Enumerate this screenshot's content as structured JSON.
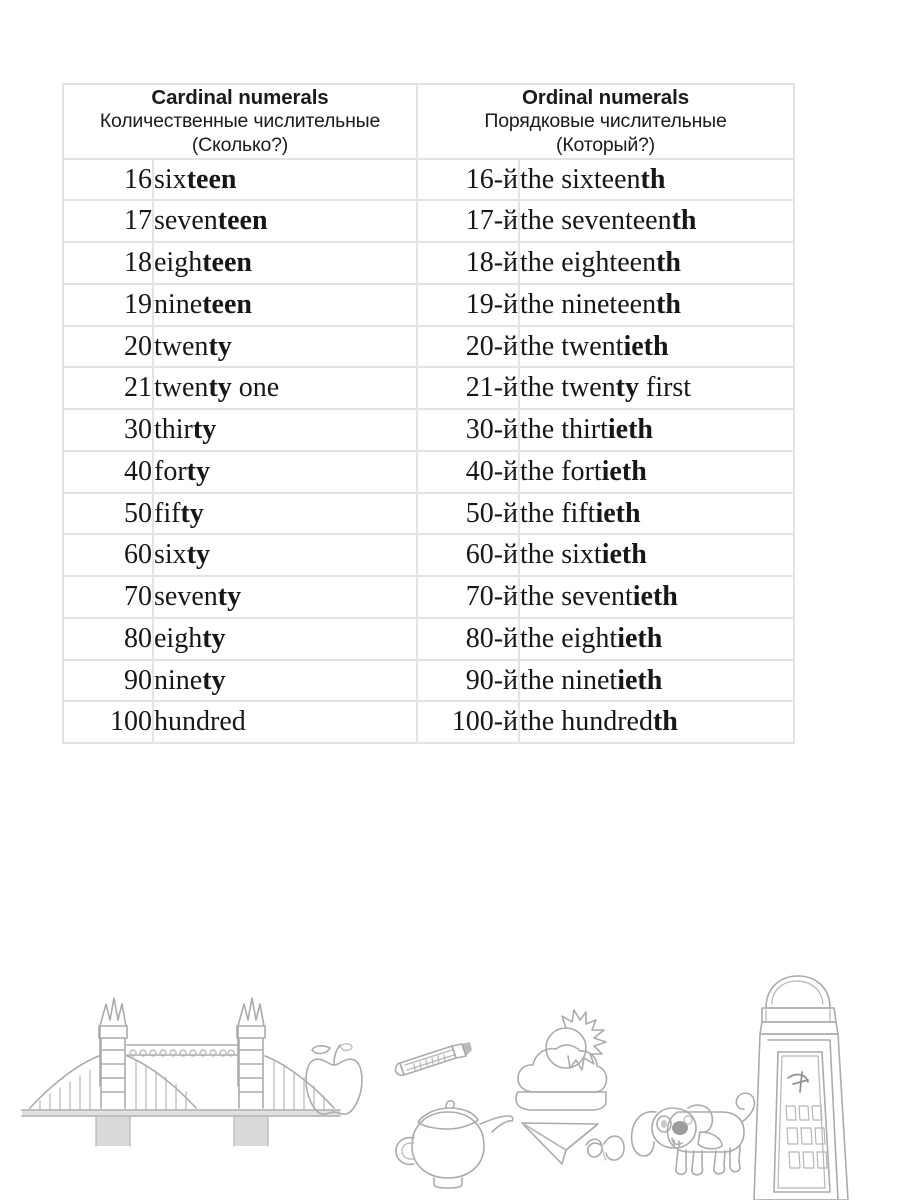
{
  "table": {
    "headers": [
      {
        "en": "Cardinal numerals",
        "ru": "Количественные числительные",
        "question": "(Сколько?)"
      },
      {
        "en": "Ordinal numerals",
        "ru": "Порядковые числительные",
        "question": "(Который?)"
      }
    ],
    "rows": [
      {
        "num": "16",
        "word_plain": "six",
        "word_bold": "teen",
        "word_tail": "",
        "onum": "16-й",
        "oword_plain": "the sixteen",
        "oword_bold": "th",
        "oword_tail": ""
      },
      {
        "num": "17",
        "word_plain": "seven",
        "word_bold": "teen",
        "word_tail": "",
        "onum": "17-й",
        "oword_plain": "the seventeen",
        "oword_bold": "th",
        "oword_tail": ""
      },
      {
        "num": "18",
        "word_plain": "eigh",
        "word_bold": "teen",
        "word_tail": "",
        "onum": "18-й",
        "oword_plain": "the eighteen",
        "oword_bold": "th",
        "oword_tail": ""
      },
      {
        "num": "19",
        "word_plain": "nine",
        "word_bold": "teen",
        "word_tail": "",
        "onum": "19-й",
        "oword_plain": "the nineteen",
        "oword_bold": "th",
        "oword_tail": ""
      },
      {
        "num": "20",
        "word_plain": "twen",
        "word_bold": "ty",
        "word_tail": "",
        "onum": "20-й",
        "oword_plain": "the twent",
        "oword_bold": "ieth",
        "oword_tail": ""
      },
      {
        "num": "21",
        "word_plain": "twen",
        "word_bold": "ty",
        "word_tail": " one",
        "onum": "21-й",
        "oword_plain": "the twen",
        "oword_bold": "ty",
        "oword_tail": " first"
      },
      {
        "num": "30",
        "word_plain": "thir",
        "word_bold": "ty",
        "word_tail": "",
        "onum": "30-й",
        "oword_plain": "the thirt",
        "oword_bold": "ieth",
        "oword_tail": ""
      },
      {
        "num": "40",
        "word_plain": "for",
        "word_bold": "ty",
        "word_tail": "",
        "onum": "40-й",
        "oword_plain": "the fort",
        "oword_bold": "ieth",
        "oword_tail": ""
      },
      {
        "num": "50",
        "word_plain": "fif",
        "word_bold": "ty",
        "word_tail": "",
        "onum": "50-й",
        "oword_plain": "the fift",
        "oword_bold": "ieth",
        "oword_tail": ""
      },
      {
        "num": "60",
        "word_plain": "six",
        "word_bold": "ty",
        "word_tail": "",
        "onum": "60-й",
        "oword_plain": "the sixt",
        "oword_bold": "ieth",
        "oword_tail": ""
      },
      {
        "num": "70",
        "word_plain": "seven",
        "word_bold": "ty",
        "word_tail": "",
        "onum": "70-й",
        "oword_plain": "the sevent",
        "oword_bold": "ieth",
        "oword_tail": ""
      },
      {
        "num": "80",
        "word_plain": "eigh",
        "word_bold": "ty",
        "word_tail": "",
        "onum": "80-й",
        "oword_plain": "the eight",
        "oword_bold": "ieth",
        "oword_tail": ""
      },
      {
        "num": "90",
        "word_plain": "nine",
        "word_bold": "ty",
        "word_tail": "",
        "onum": "90-й",
        "oword_plain": "the ninet",
        "oword_bold": "ieth",
        "oword_tail": ""
      },
      {
        "num": "100",
        "word_plain": "hundred",
        "word_bold": "",
        "word_tail": "",
        "onum": "100-й",
        "oword_plain": "the hundred",
        "oword_bold": "th",
        "oword_tail": ""
      }
    ]
  },
  "illustrations": [
    {
      "name": "tower-bridge-illustration"
    },
    {
      "name": "apple-illustration"
    },
    {
      "name": "pencil-illustration"
    },
    {
      "name": "teapot-illustration"
    },
    {
      "name": "sun-behind-cloud-illustration"
    },
    {
      "name": "paper-plane-illustration"
    },
    {
      "name": "dog-illustration"
    },
    {
      "name": "telephone-box-illustration"
    }
  ],
  "colors": {
    "border": "#e3e3e3",
    "text": "#15181b",
    "illustration_ink": "#a9abad",
    "background": "#ffffff"
  }
}
